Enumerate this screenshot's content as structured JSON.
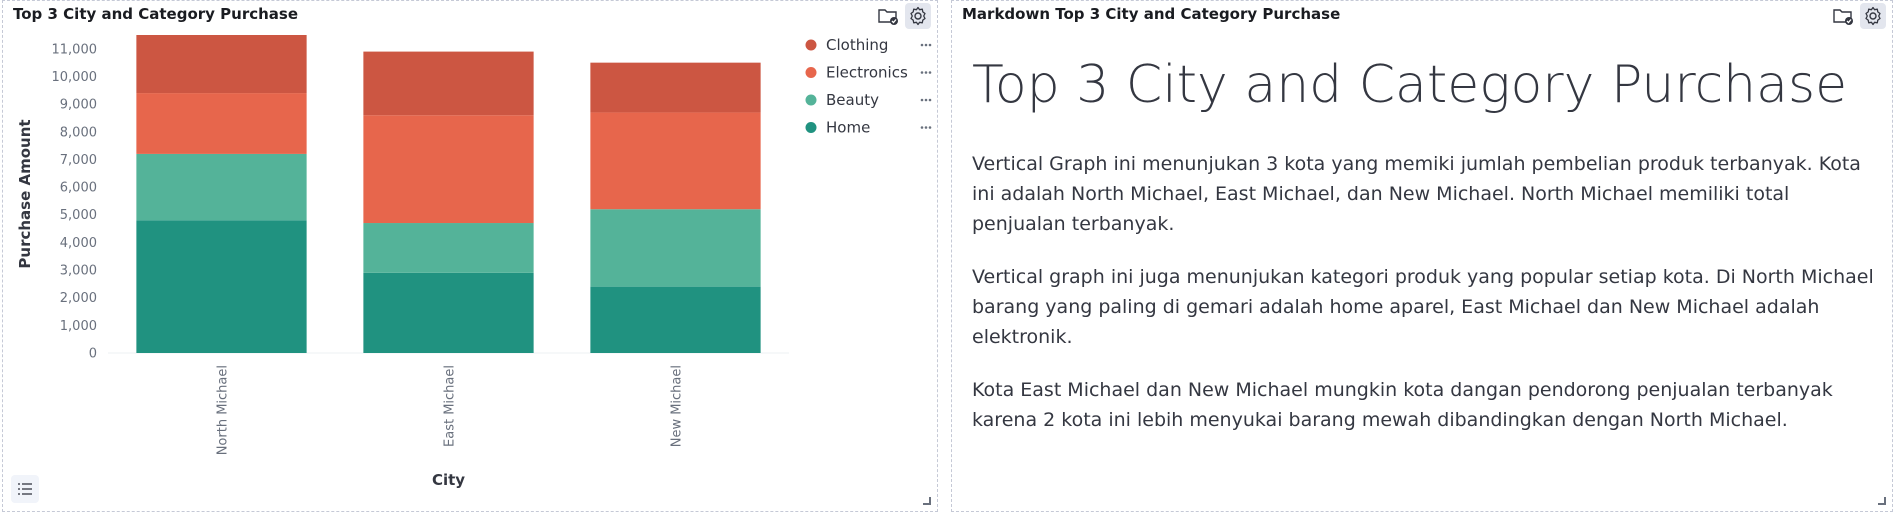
{
  "panels": {
    "chart": {
      "title": "Top 3 City and Category Purchase"
    },
    "markdown": {
      "title": "Markdown Top 3 City and Category Purchase",
      "heading": "Top 3 City and Category Purchase",
      "paragraphs": [
        "Vertical Graph ini menunjukan 3 kota yang memiki jumlah pembelian produk terbanyak. Kota ini adalah North Michael, East Michael, dan New Michael. North Michael memiliki total penjualan terbanyak.",
        "Vertical graph ini juga menunjukan kategori produk yang popular setiap kota. Di North Michael barang yang paling di gemari adalah home aparel, East Michael dan New Michael adalah elektronik.",
        "Kota East Michael dan New Michael mungkin kota dangan pendorong penjualan terbanyak karena 2 kota ini lebih menyukai barang mewah dibandingkan dengan North Michael."
      ]
    }
  },
  "icons": {
    "folder": "folder-check-icon",
    "settings": "gear-icon",
    "legend": "list-icon"
  },
  "chart_data": {
    "type": "bar",
    "stacked": true,
    "categories": [
      "North Michael",
      "East Michael",
      "New Michael"
    ],
    "series": [
      {
        "name": "Home",
        "color": "#209280",
        "values": [
          4800,
          2900,
          2400
        ]
      },
      {
        "name": "Beauty",
        "color": "#54b399",
        "values": [
          2400,
          1800,
          2800
        ]
      },
      {
        "name": "Electronics",
        "color": "#e7664c",
        "values": [
          2200,
          3900,
          3500
        ]
      },
      {
        "name": "Clothing",
        "color": "#cc5642",
        "values": [
          2100,
          2300,
          1800
        ]
      }
    ],
    "legend_order": [
      "Clothing",
      "Electronics",
      "Beauty",
      "Home"
    ],
    "xlabel": "City",
    "ylabel": "Purchase Amount",
    "ylim": [
      0,
      11500
    ],
    "yticks": [
      0,
      1000,
      2000,
      3000,
      4000,
      5000,
      6000,
      7000,
      8000,
      9000,
      10000,
      11000
    ],
    "ytick_labels": [
      "0",
      "1,000",
      "2,000",
      "3,000",
      "4,000",
      "5,000",
      "6,000",
      "7,000",
      "8,000",
      "9,000",
      "10,000",
      "11,000"
    ],
    "legend_position": "top-right"
  }
}
